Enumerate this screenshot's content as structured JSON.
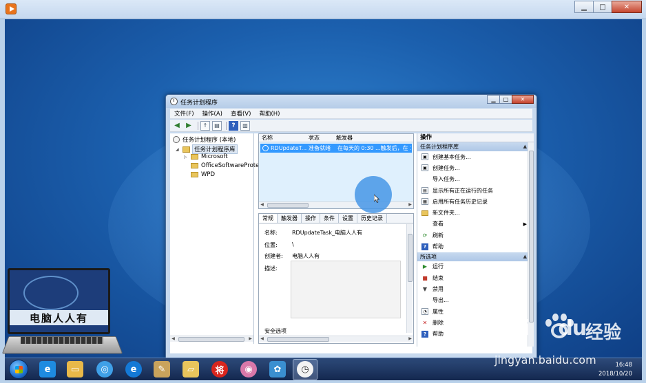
{
  "outer": {
    "minimize": "▁",
    "maximize": "□",
    "close": "✕"
  },
  "window": {
    "title": "任务计划程序",
    "menu": [
      "文件(F)",
      "操作(A)",
      "查看(V)",
      "帮助(H)"
    ]
  },
  "tree": {
    "root": "任务计划程序 (本地)",
    "library": "任务计划程序库",
    "folders": [
      "Microsoft",
      "OfficeSoftwareProte",
      "WPD"
    ]
  },
  "tasklist": {
    "columns": [
      "名称",
      "状态",
      "触发器"
    ],
    "row": {
      "name": "RDUpdateT...",
      "status": "准备就绪",
      "trigger": "在每天的 0:30 ...触发后，在 1"
    }
  },
  "details": {
    "tabs": [
      "常规",
      "触发器",
      "操作",
      "条件",
      "设置",
      "历史记录"
    ],
    "name_label": "名称:",
    "name_value": "RDUpdateTask_电脑人人有",
    "location_label": "位置:",
    "location_value": "\\",
    "author_label": "创建者:",
    "author_value": "电脑人人有",
    "desc_label": "描述:",
    "security_label": "安全选项"
  },
  "actions": {
    "title": "操作",
    "section1": "任务计划程序库",
    "items1": [
      "创建基本任务...",
      "创建任务...",
      "导入任务...",
      "显示所有正在运行的任务",
      "启用所有任务历史记录",
      "新文件夹...",
      "查看",
      "刷新",
      "帮助"
    ],
    "section2": "所选项",
    "items2": [
      "运行",
      "结束",
      "禁用",
      "导出...",
      "属性",
      "删除",
      "帮助"
    ]
  },
  "logo": {
    "text": "电脑人人有"
  },
  "taskbar": {
    "time": "16:48",
    "date": "2018/10/20"
  },
  "watermark": {
    "brand": "Bai",
    "brand2": "du",
    "jingyan": "经验",
    "url": "jingyan.baidu.com"
  }
}
